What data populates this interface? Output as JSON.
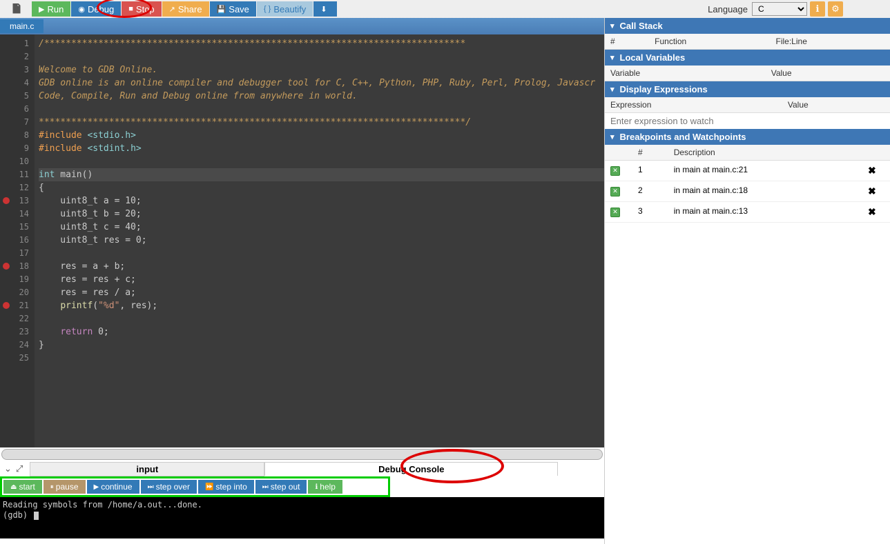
{
  "toolbar": {
    "run": "Run",
    "debug": "Debug",
    "stop": "Stop",
    "share": "Share",
    "save": "Save",
    "beautify": "Beautify",
    "language_label": "Language",
    "language_value": "C"
  },
  "tab": "main.c",
  "gutter": {
    "lines": [
      "1",
      "2",
      "3",
      "4",
      "5",
      "6",
      "7",
      "8",
      "9",
      "10",
      "11",
      "12",
      "13",
      "14",
      "15",
      "16",
      "17",
      "18",
      "19",
      "20",
      "21",
      "22",
      "23",
      "24",
      "25"
    ],
    "breakpoints": [
      13,
      18,
      21
    ]
  },
  "code": {
    "l1": "/******************************************************************************",
    "l2": "",
    "l3": "Welcome to GDB Online.",
    "l4": "GDB online is an online compiler and debugger tool for C, C++, Python, PHP, Ruby, Perl, Prolog, Javascr",
    "l5": "Code, Compile, Run and Debug online from anywhere in world.",
    "l6": "",
    "l7": "*******************************************************************************/",
    "l8_kw": "#include",
    "l8_h": "<stdio.h>",
    "l9_kw": "#include",
    "l9_h": "<stdint.h>",
    "l11_type": "int",
    "l11_name": " main()",
    "l12": "{",
    "l13": "    uint8_t a = 10;",
    "l14": "    uint8_t b = 20;",
    "l15": "    uint8_t c = 40;",
    "l16": "    uint8_t res = 0;",
    "l18": "    res = a + b;",
    "l19": "    res = res + c;",
    "l20": "    res = res / a;",
    "l21a": "    ",
    "l21b": "printf",
    "l21c": "(",
    "l21d": "\"%d\"",
    "l21e": ", res);",
    "l23a": "    ",
    "l23b": "return",
    "l23c": " 0;",
    "l24": "}"
  },
  "bottom": {
    "input_tab": "input",
    "console_tab": "Debug Console",
    "start": "start",
    "pause": "pause",
    "continue": "continue",
    "step_over": "step over",
    "step_into": "step into",
    "step_out": "step out",
    "help": "help",
    "console_l1": "Reading symbols from /home/a.out...done.",
    "console_l2": "(gdb) "
  },
  "right": {
    "callstack": {
      "title": "Call Stack",
      "h1": "#",
      "h2": "Function",
      "h3": "File:Line"
    },
    "locals": {
      "title": "Local Variables",
      "h1": "Variable",
      "h2": "Value"
    },
    "expressions": {
      "title": "Display Expressions",
      "h1": "Expression",
      "h2": "Value",
      "placeholder": "Enter expression to watch"
    },
    "breakpoints": {
      "title": "Breakpoints and Watchpoints",
      "h1": "#",
      "h2": "Description",
      "rows": [
        {
          "num": "1",
          "desc": "in main at main.c:21"
        },
        {
          "num": "2",
          "desc": "in main at main.c:18"
        },
        {
          "num": "3",
          "desc": "in main at main.c:13"
        }
      ]
    }
  }
}
